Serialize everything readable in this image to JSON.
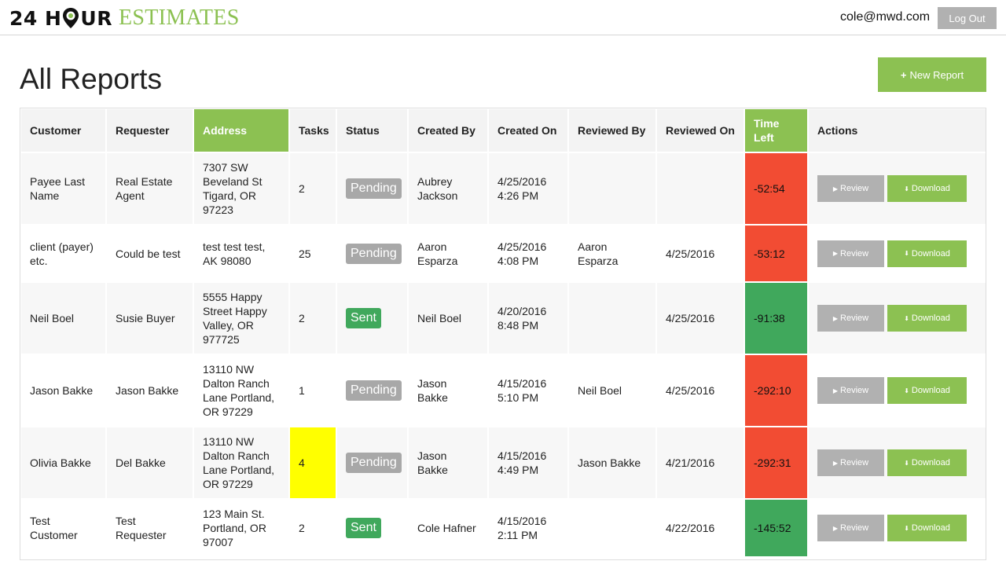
{
  "header": {
    "logo_part1": "24 H",
    "logo_part2": "UR",
    "logo_part3": "ESTIMATES",
    "user_email": "cole@mwd.com",
    "logout_label": "Log Out"
  },
  "page": {
    "title": "All Reports",
    "new_report_label": "New Report",
    "new_report_icon": "+"
  },
  "colors": {
    "brand_green": "#8cc152",
    "status_green": "#40a85c",
    "overdue_red": "#f24c33",
    "highlight_yellow": "#ffff00",
    "neutral_gray": "#b1b1b1"
  },
  "table": {
    "columns": [
      "Customer",
      "Requester",
      "Address",
      "Tasks",
      "Status",
      "Created By",
      "Created On",
      "Reviewed By",
      "Reviewed On",
      "Time Left",
      "Actions"
    ],
    "review_label": "Review",
    "download_label": "Download",
    "review_icon": "▶",
    "download_icon": "⬇",
    "rows": [
      {
        "customer": "Payee Last Name",
        "requester": "Real Estate Agent",
        "address": "7307 SW Beveland St Tigard, OR 97223",
        "tasks": "2",
        "status": "Pending",
        "created_by": "Aubrey Jackson",
        "created_on": "4/25/2016 4:26 PM",
        "reviewed_by": "",
        "reviewed_on": "",
        "time_left": "-52:54"
      },
      {
        "customer": "client (payer) etc.",
        "requester": "Could be test",
        "address": "test test test, AK 98080",
        "tasks": "25",
        "status": "Pending",
        "created_by": "Aaron Esparza",
        "created_on": "4/25/2016 4:08 PM",
        "reviewed_by": "Aaron Esparza",
        "reviewed_on": "4/25/2016",
        "time_left": "-53:12"
      },
      {
        "customer": "Neil Boel",
        "requester": "Susie Buyer",
        "address": "5555 Happy Street Happy Valley, OR 977725",
        "tasks": "2",
        "status": "Sent",
        "created_by": "Neil Boel",
        "created_on": "4/20/2016 8:48 PM",
        "reviewed_by": "",
        "reviewed_on": "4/25/2016",
        "time_left": "-91:38"
      },
      {
        "customer": "Jason Bakke",
        "requester": "Jason Bakke",
        "address": "13110 NW Dalton Ranch Lane Portland, OR 97229",
        "tasks": "1",
        "status": "Pending",
        "created_by": "Jason Bakke",
        "created_on": "4/15/2016 5:10 PM",
        "reviewed_by": "Neil Boel",
        "reviewed_on": "4/25/2016",
        "time_left": "-292:10"
      },
      {
        "customer": "Olivia Bakke",
        "requester": "Del Bakke",
        "address": "13110 NW Dalton Ranch Lane Portland, OR 97229",
        "tasks": "4",
        "status": "Pending",
        "created_by": "Jason Bakke",
        "created_on": "4/15/2016 4:49 PM",
        "reviewed_by": "Jason Bakke",
        "reviewed_on": "4/21/2016",
        "time_left": "-292:31"
      },
      {
        "customer": "Test Customer",
        "requester": "Test Requester",
        "address": "123 Main St. Portland, OR 97007",
        "tasks": "2",
        "status": "Sent",
        "created_by": "Cole Hafner",
        "created_on": "4/15/2016 2:11 PM",
        "reviewed_by": "",
        "reviewed_on": "4/22/2016",
        "time_left": "-145:52"
      }
    ]
  }
}
